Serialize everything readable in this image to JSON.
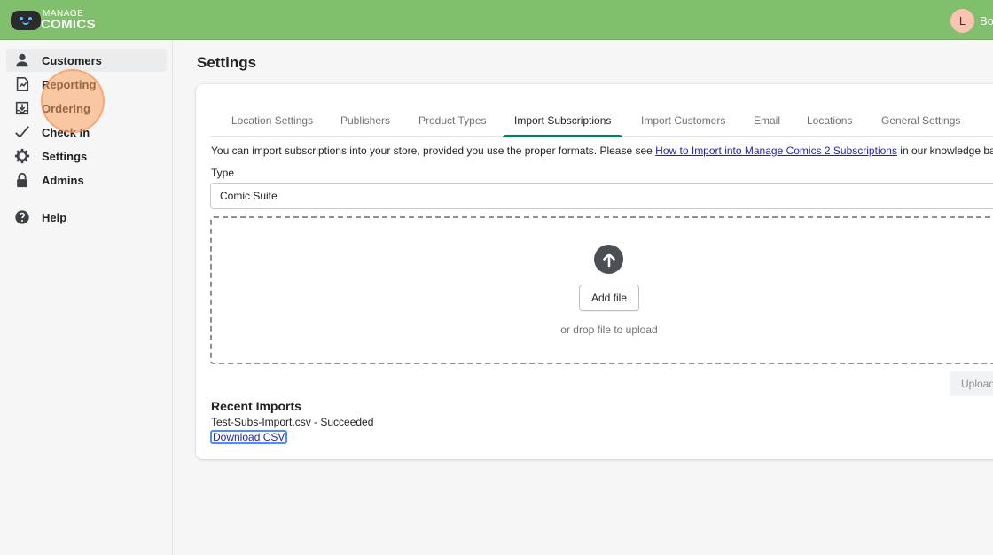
{
  "header": {
    "logo_line1": "MANAGE",
    "logo_line2": "COMICS",
    "avatar_initial": "L",
    "user_name": "Bo"
  },
  "sidebar": {
    "items": [
      {
        "label": "Customers",
        "icon": "person-icon"
      },
      {
        "label": "Reporting",
        "icon": "report-icon"
      },
      {
        "label": "Ordering",
        "icon": "download-tray-icon"
      },
      {
        "label": "Check In",
        "icon": "checkmark-icon"
      },
      {
        "label": "Settings",
        "icon": "gear-icon"
      },
      {
        "label": "Admins",
        "icon": "lock-icon"
      },
      {
        "label": "Help",
        "icon": "question-circle-icon"
      }
    ]
  },
  "main": {
    "title": "Settings",
    "tabs": [
      {
        "label": "Location Settings"
      },
      {
        "label": "Publishers"
      },
      {
        "label": "Product Types"
      },
      {
        "label": "Import Subscriptions"
      },
      {
        "label": "Import Customers"
      },
      {
        "label": "Email"
      },
      {
        "label": "Locations"
      },
      {
        "label": "General Settings"
      }
    ],
    "active_tab": "Import Subscriptions",
    "info_prefix": "You can import subscriptions into your store, provided you use the proper formats. Please see ",
    "info_link": "How to Import into Manage Comics 2 Subscriptions",
    "info_suffix": " in our knowledge base",
    "type_label": "Type",
    "type_value": "Comic Suite",
    "add_file_label": "Add file",
    "drop_text": "or drop file to upload",
    "upload_label": "Upload",
    "recent_title": "Recent Imports",
    "recent_item": "Test-Subs-Import.csv - Succeeded",
    "download_label": "Download CSV"
  },
  "colors": {
    "topbar": "#80bf6c",
    "active_tab_indicator": "#008060",
    "link": "#1f1fbf"
  }
}
